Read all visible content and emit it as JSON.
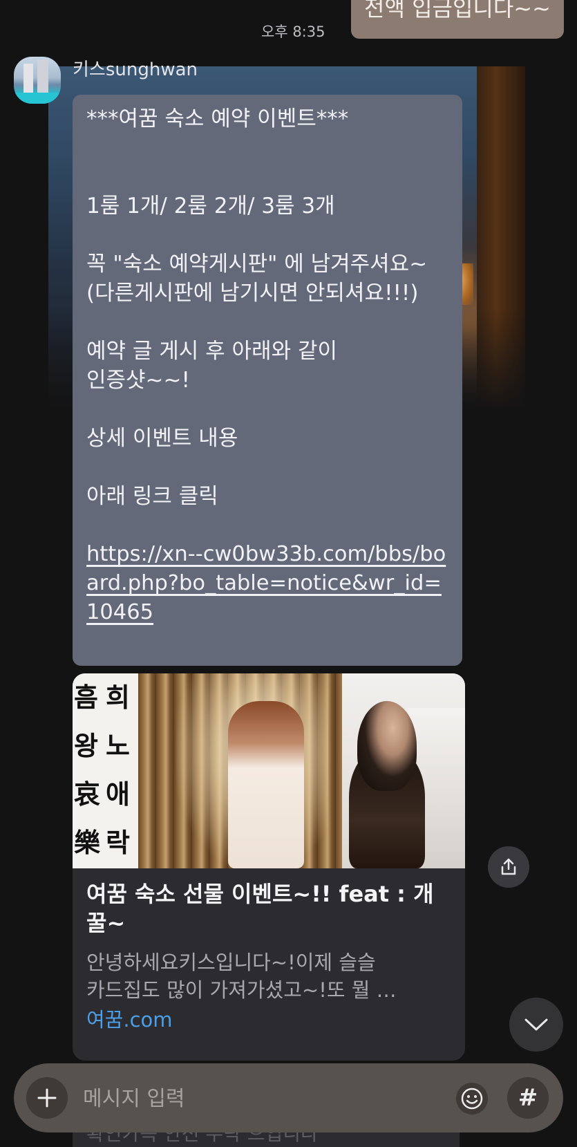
{
  "outgoing": {
    "text": "전액 입금입니다~~",
    "time": "오후 8:35"
  },
  "sender": {
    "name": "키스sunghwan"
  },
  "message": {
    "lines": [
      "***여꿈 숙소 예약 이벤트***",
      "",
      "",
      "1룸 1개/ 2룸 2개/ 3룸 3개",
      "",
      "꼭  \"숙소 예약게시판\" 에 남겨주셔요~",
      "(다른게시판에 남기시면 안되셔요!!!)",
      "",
      "예약 글 게시 후 아래와 같이",
      "인증샷~~!",
      "",
      "상세 이벤트 내용",
      "",
      "아래 링크 클릭",
      ""
    ],
    "link": "https://xn--cw0bw33b.com/bbs/board.php?bo_table=notice&wr_id=10465"
  },
  "link_preview": {
    "calligraphy_left": [
      "흠",
      "왕",
      "哀",
      "樂"
    ],
    "calligraphy_right": [
      "희",
      "노",
      "애",
      "락"
    ],
    "title": "여꿈 숙소 선물 이벤트~!! feat : 개꿀~",
    "description_line1": "안녕하세요키스입니다~!이제 슬슬",
    "description_line2": "카드집도 많이 가져가셨고~!또 뭘 …",
    "domain": "여꿈.com"
  },
  "peek_text": "확인가득 안전 우락 으입니다",
  "composer": {
    "placeholder": "메시지 입력",
    "hash_label": "#"
  },
  "icons": {
    "share": "share-icon",
    "scroll_down": "chevron-down-icon",
    "add": "plus-icon",
    "emoji": "emoji-icon"
  },
  "colors": {
    "background": "#131314",
    "bubble": "#636979",
    "outgoing_bubble": "#8c7b71",
    "link_domain": "#4a9fe8",
    "input_bar": "#58524e"
  }
}
